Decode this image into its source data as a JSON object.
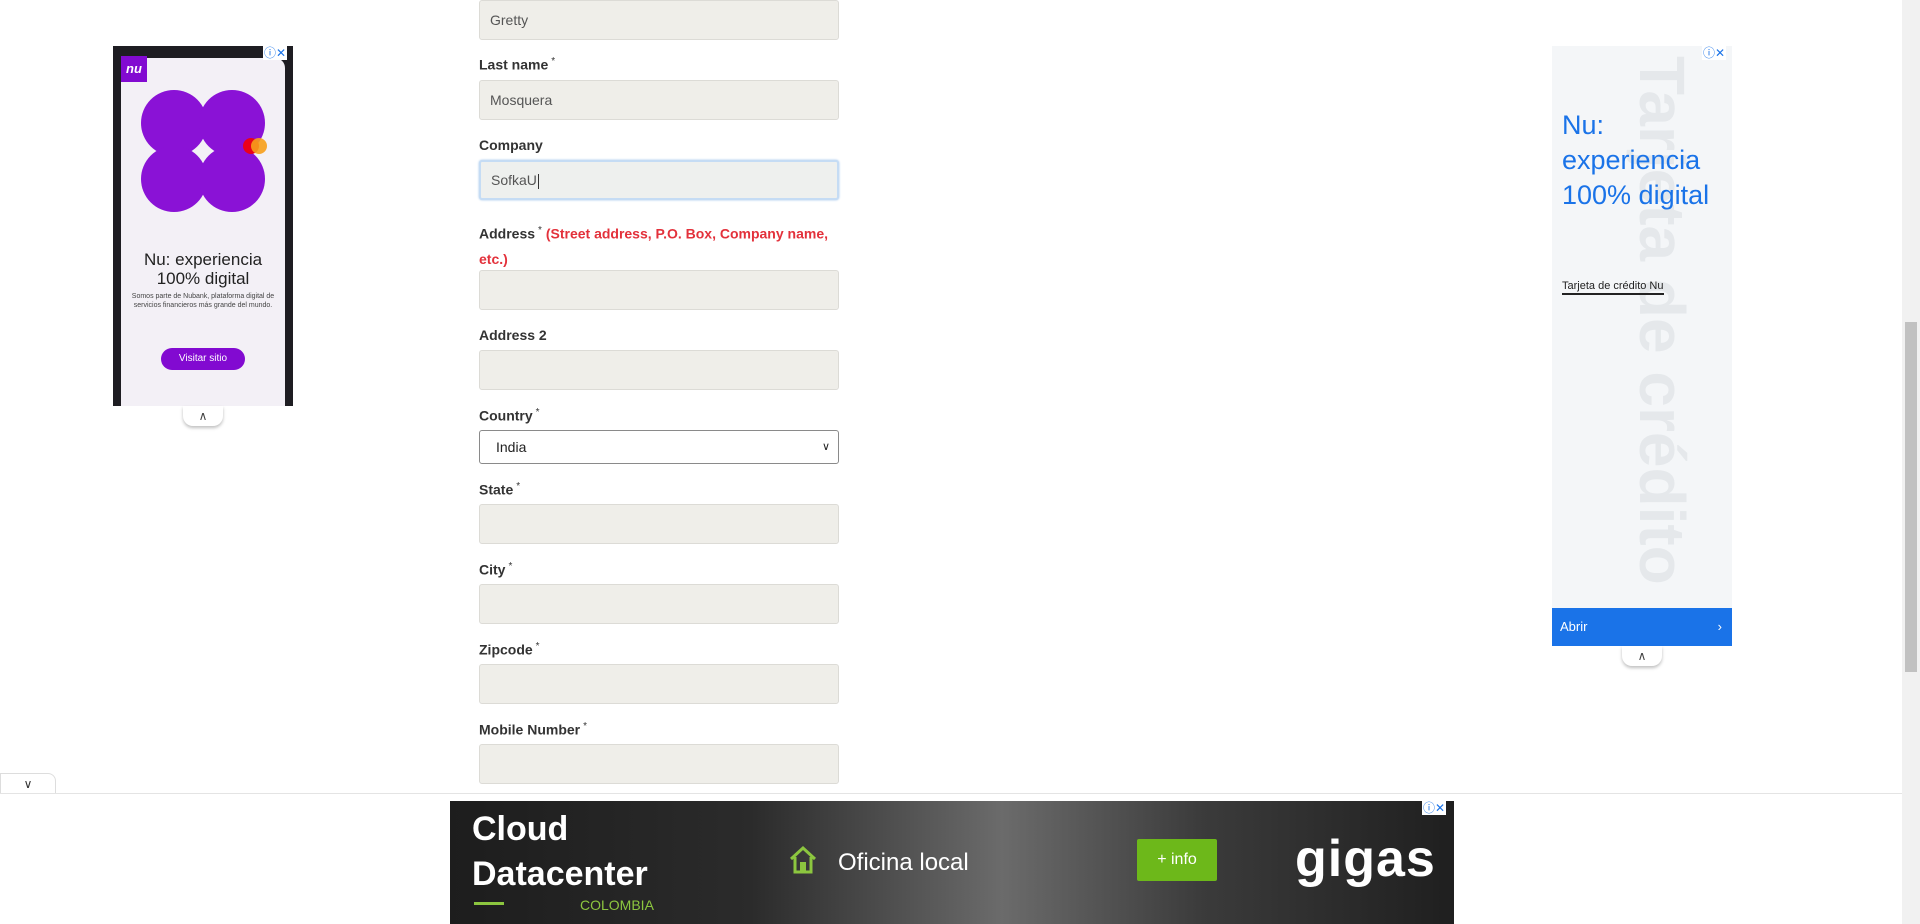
{
  "form": {
    "first_name_value": "Gretty",
    "last_name_label": "Last name",
    "last_name_value": "Mosquera",
    "company_label": "Company",
    "company_value": "SofkaU",
    "address_label": "Address",
    "address_hint": "(Street address, P.O. Box, Company name, etc.)",
    "address_value": "",
    "address2_label": "Address 2",
    "address2_value": "",
    "country_label": "Country",
    "country_value": "India",
    "state_label": "State",
    "state_value": "",
    "city_label": "City",
    "city_value": "",
    "zipcode_label": "Zipcode",
    "zipcode_value": "",
    "mobile_label": "Mobile Number",
    "mobile_value": "",
    "required_mark": "*"
  },
  "ad_left": {
    "logo": "nu",
    "headline": "Nu: experiencia 100% digital",
    "body": "Somos parte de Nubank, plataforma digital de servicios financieros más grande del mundo.",
    "cta": "Visitar sitio",
    "icons": [
      "info-icon",
      "close-icon"
    ]
  },
  "ad_right": {
    "title": "Nu: experiencia 100% digital",
    "subtitle": "Tarjeta de crédito Nu",
    "button": "Abrir",
    "watermark": "Tarjeta de crédito"
  },
  "ad_bottom": {
    "headline": "Cloud Datacenter",
    "country": "COLOMBIA",
    "office": "Oficina local",
    "cta": "+ info",
    "brand": "gigas"
  },
  "colors": {
    "accent_blue": "#1a73e8",
    "nu_purple": "#820ad1",
    "hint_red": "#e3313b",
    "gigas_green": "#6db81a",
    "input_bg": "#efeee9"
  }
}
